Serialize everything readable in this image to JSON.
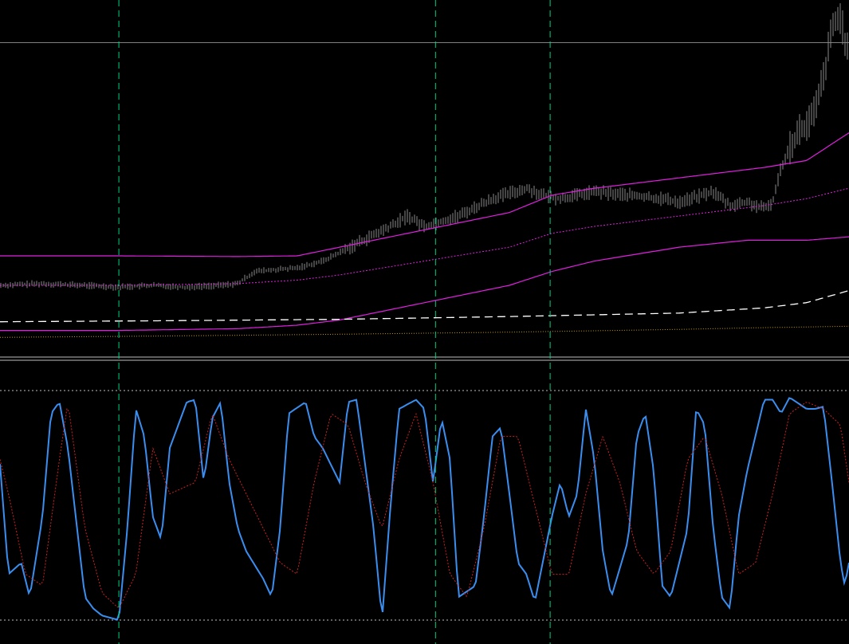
{
  "chart_data": [
    {
      "type": "line",
      "name": "price-panel",
      "ylim": [
        0,
        100
      ],
      "grid": false,
      "colors": {
        "background": "#000000",
        "price_bars": "#8a8a8a",
        "ma_solid": "#e020e0",
        "ma_dotted": "#e020e0",
        "dashed_line": "#ffffff",
        "dotted_yellow": "#c8a000",
        "horizontal_level": "#808080",
        "vertical_markers": "#00d080"
      },
      "horizontal_level": 90,
      "vertical_markers": [
        14,
        51.3,
        64.8
      ],
      "price_series": {
        "x": [
          0,
          5,
          10,
          14,
          18,
          22,
          26,
          28,
          30,
          35,
          38,
          42,
          46,
          48,
          50,
          54,
          58,
          62,
          64,
          66,
          70,
          74,
          78,
          80,
          84,
          86,
          88,
          90,
          91,
          92,
          93,
          94,
          95,
          96,
          97,
          98,
          99,
          100
        ],
        "close": [
          20,
          20.5,
          20,
          19.5,
          20,
          19.5,
          20,
          20.5,
          24,
          25,
          27,
          32,
          37,
          40,
          37,
          40,
          45,
          48,
          46,
          45,
          47,
          46,
          45,
          44,
          47,
          43,
          44,
          42,
          44,
          54,
          60,
          64,
          66,
          70,
          80,
          94,
          98,
          85
        ]
      },
      "series": [
        {
          "line": "ma_solid_upper",
          "x": [
            0,
            14,
            28,
            35,
            40,
            50,
            60,
            65,
            70,
            80,
            90,
            95,
            100
          ],
          "values": [
            28.5,
            28.5,
            28.3,
            28.5,
            31,
            36,
            41,
            46,
            48,
            51,
            54,
            56,
            64
          ]
        },
        {
          "line": "ma_dotted_mid",
          "x": [
            0,
            14,
            28,
            35,
            40,
            50,
            60,
            65,
            70,
            80,
            90,
            95,
            100
          ],
          "values": [
            20,
            20,
            20.5,
            21.5,
            23,
            27,
            31,
            35,
            37,
            40,
            43,
            45,
            48
          ]
        },
        {
          "line": "ma_solid_lower",
          "x": [
            0,
            14,
            28,
            35,
            40,
            50,
            60,
            65,
            70,
            80,
            88,
            95,
            100
          ],
          "values": [
            7,
            7,
            7.5,
            8.5,
            10,
            15,
            20,
            24,
            27,
            31,
            33,
            33,
            34
          ]
        },
        {
          "line": "dashed_white",
          "x": [
            0,
            20,
            40,
            60,
            80,
            90,
            95,
            100
          ],
          "values": [
            9.5,
            9.8,
            10.2,
            11,
            12,
            13.5,
            15,
            18.5
          ]
        },
        {
          "line": "dotted_yellow",
          "x": [
            0,
            20,
            40,
            60,
            80,
            90,
            100
          ],
          "values": [
            5,
            5.4,
            5.9,
            6.5,
            7.3,
            7.8,
            8.2
          ]
        }
      ]
    },
    {
      "type": "line",
      "name": "stochastic-panel",
      "ylim": [
        0,
        100
      ],
      "grid": false,
      "levels": [
        100,
        0
      ],
      "colors": {
        "main": "#3a8ef0",
        "signal": "#d02020",
        "levels": "#c0c0c0",
        "vertical_markers": "#00d080"
      },
      "series": [
        {
          "line": "main",
          "x": [
            0,
            1,
            2.5,
            3.5,
            5,
            6,
            7,
            8,
            10,
            11,
            12,
            14,
            15,
            16,
            17,
            18,
            19,
            20,
            22,
            23,
            24,
            25,
            26,
            27,
            28,
            29,
            31,
            32,
            33,
            34,
            36,
            37,
            38,
            40,
            41,
            42,
            44,
            45,
            46,
            47,
            49,
            50,
            51,
            52,
            53,
            54,
            56,
            57,
            58,
            59,
            60,
            61,
            62,
            63,
            65,
            66,
            67,
            68,
            69,
            70,
            71,
            72,
            74,
            75,
            76,
            77,
            78,
            79,
            81,
            82,
            83,
            84,
            85,
            86,
            87,
            88,
            90,
            91,
            92,
            93,
            95,
            96,
            97,
            98,
            99,
            99.5,
            100
          ],
          "values": [
            68,
            20,
            25,
            10,
            45,
            90,
            95,
            75,
            10,
            5,
            2,
            0,
            40,
            92,
            80,
            45,
            35,
            75,
            95,
            96,
            60,
            88,
            95,
            60,
            40,
            30,
            18,
            10,
            40,
            90,
            95,
            80,
            75,
            60,
            95,
            96,
            40,
            0,
            50,
            92,
            96,
            92,
            60,
            88,
            70,
            10,
            15,
            45,
            80,
            84,
            55,
            25,
            20,
            8,
            45,
            60,
            45,
            55,
            92,
            70,
            30,
            10,
            35,
            80,
            90,
            65,
            15,
            10,
            40,
            92,
            85,
            40,
            10,
            5,
            45,
            65,
            96,
            96,
            90,
            97,
            92,
            92,
            93,
            60,
            25,
            15,
            25
          ]
        },
        {
          "line": "signal",
          "x": [
            0,
            1,
            3,
            5,
            7,
            8,
            10,
            12,
            14,
            16,
            18,
            20,
            23,
            25,
            27,
            29,
            31,
            33,
            35,
            37,
            39,
            41,
            43,
            45,
            47,
            49,
            51,
            53,
            55,
            57,
            59,
            61,
            63,
            65,
            67,
            69,
            71,
            73,
            75,
            77,
            79,
            81,
            83,
            85,
            87,
            89,
            91,
            93,
            95,
            97,
            99,
            100
          ],
          "values": [
            70,
            55,
            20,
            15,
            70,
            95,
            40,
            12,
            5,
            20,
            75,
            55,
            60,
            90,
            70,
            55,
            40,
            25,
            20,
            60,
            90,
            85,
            60,
            40,
            70,
            90,
            60,
            20,
            10,
            40,
            80,
            80,
            50,
            20,
            20,
            55,
            80,
            60,
            30,
            20,
            30,
            70,
            80,
            55,
            20,
            25,
            55,
            90,
            95,
            92,
            85,
            60
          ]
        }
      ]
    }
  ]
}
